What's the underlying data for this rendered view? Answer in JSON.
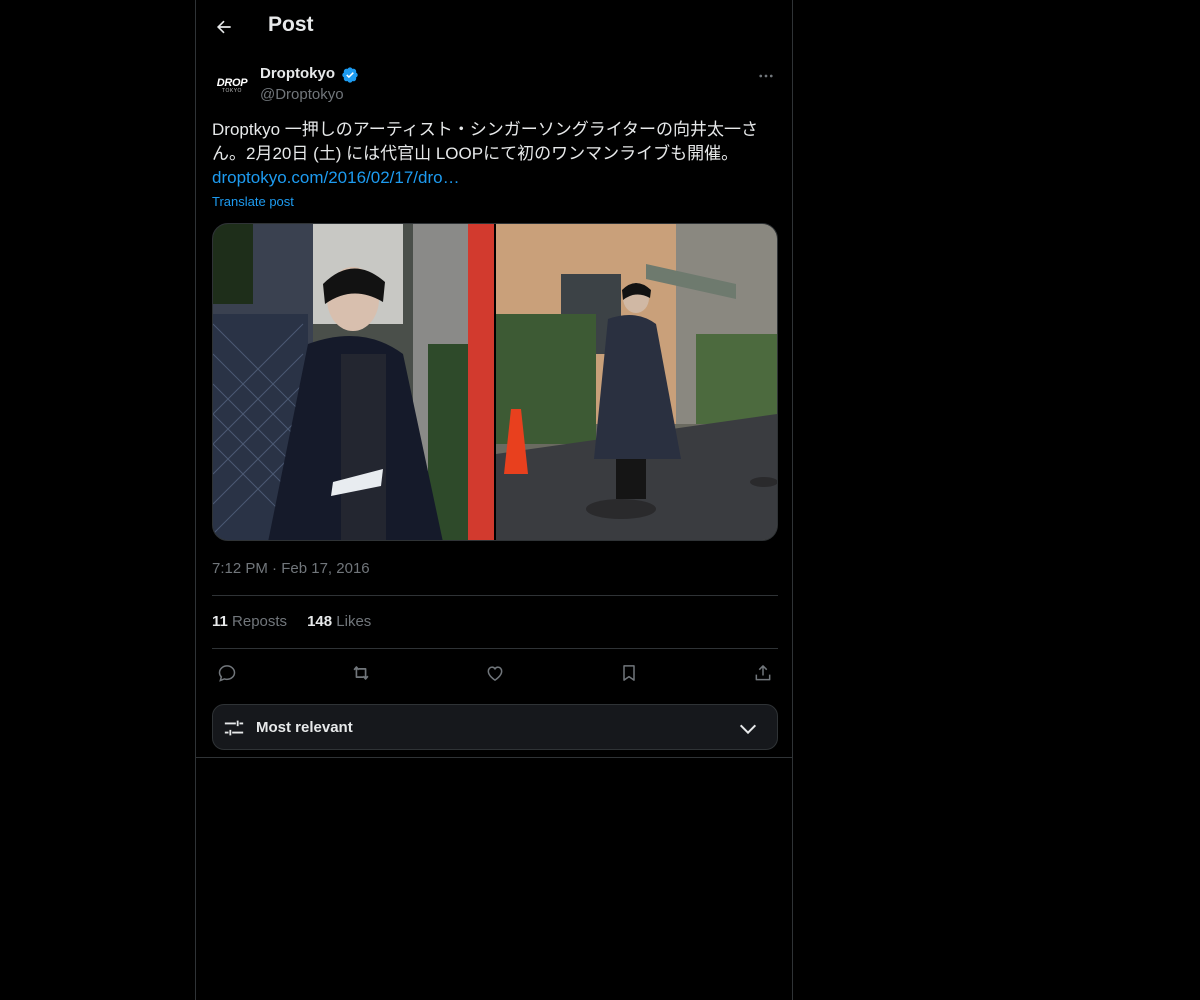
{
  "header": {
    "title": "Post"
  },
  "author": {
    "display_name": "Droptokyo",
    "handle": "@Droptokyo",
    "avatar_line1": "DROP",
    "avatar_line2": "TOKYO"
  },
  "post": {
    "text": "Droptkyo 一押しのアーティスト・シンガーソングライターの向井太一さん。2月20日 (土) には代官山 LOOPにて初のワンマンライブも開催。",
    "link": "droptokyo.com/2016/02/17/dro…",
    "translate": "Translate post",
    "time": "7:12 PM",
    "separator": "·",
    "date": "Feb 17, 2016"
  },
  "stats": {
    "reposts_count": "11",
    "reposts_label": "Reposts",
    "likes_count": "148",
    "likes_label": "Likes"
  },
  "sort": {
    "label": "Most relevant"
  },
  "colors": {
    "accent": "#1d9bf0",
    "muted": "#71767b",
    "text": "#e7e9ea",
    "border": "#2f3336"
  }
}
